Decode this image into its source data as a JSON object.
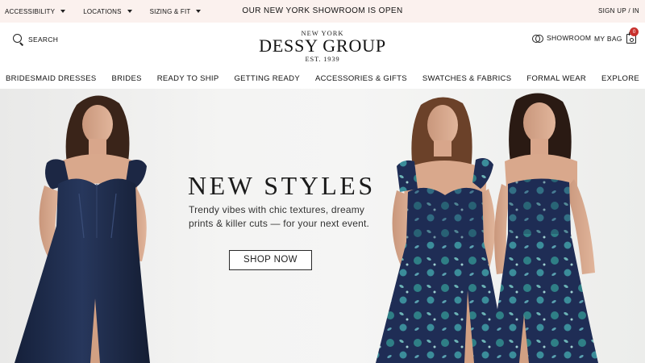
{
  "topbar": {
    "accessibility_label": "ACCESSIBILITY",
    "locations_label": "LOCATIONS",
    "sizing_label": "SIZING & FIT",
    "announcement": "OUR NEW YORK SHOWROOM IS OPEN",
    "signin_label": "SIGN UP / IN"
  },
  "header": {
    "search_label": "SEARCH",
    "logo_top": "NEW YORK",
    "logo_brand": "DESSY GROUP",
    "logo_est": "EST. 1939",
    "showroom_label": "SHOWROOM",
    "bag_label": "MY BAG",
    "bag_count": "0"
  },
  "nav": {
    "items": [
      {
        "label": "BRIDESMAID DRESSES"
      },
      {
        "label": "BRIDES"
      },
      {
        "label": "READY TO SHIP"
      },
      {
        "label": "GETTING READY"
      },
      {
        "label": "ACCESSORIES & GIFTS"
      },
      {
        "label": "SWATCHES & FABRICS"
      },
      {
        "label": "FORMAL WEAR"
      },
      {
        "label": "EXPLORE"
      }
    ]
  },
  "hero": {
    "headline": "NEW STYLES",
    "subcopy_line1": "Trendy vibes with chic textures, dreamy",
    "subcopy_line2": "prints & killer cuts — for your next event.",
    "cta_label": "SHOP NOW"
  },
  "colors": {
    "topbar_bg": "#fbf1ee",
    "navy_dress": "#1f2d4d",
    "badge": "#c8312d"
  }
}
